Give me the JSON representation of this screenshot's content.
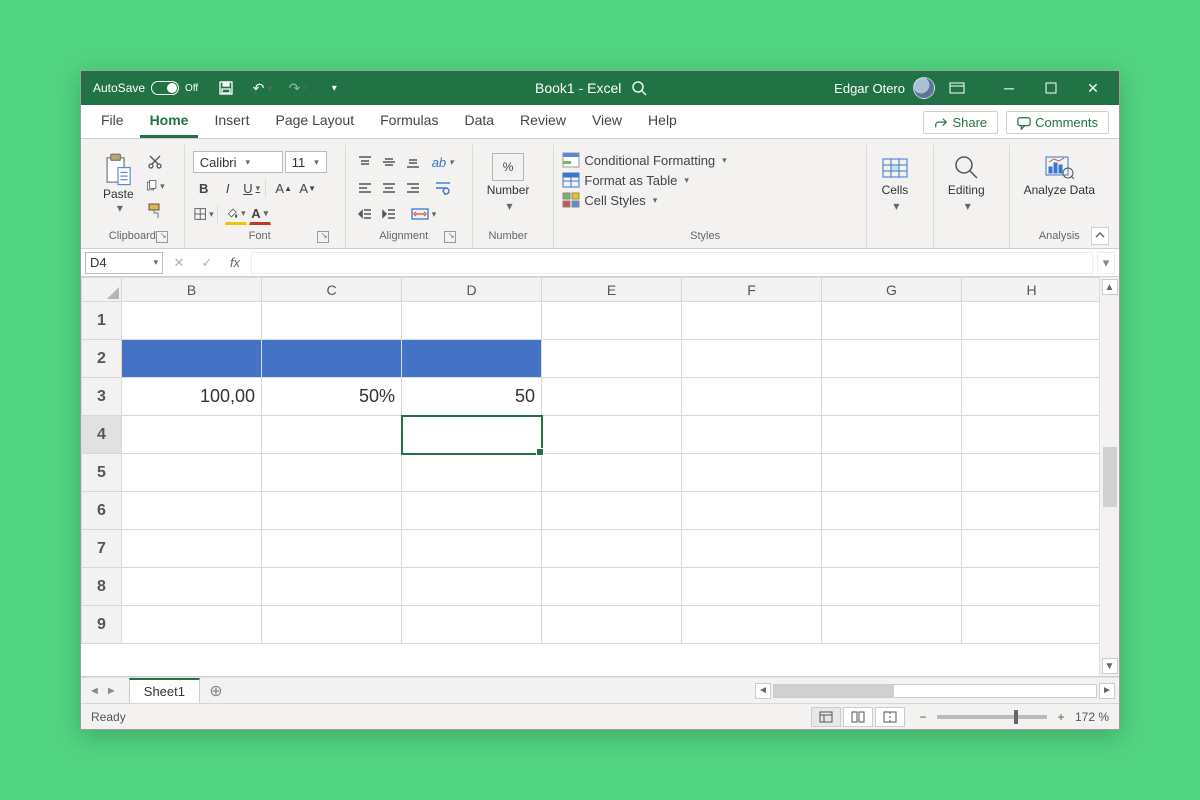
{
  "titlebar": {
    "autosave_label": "AutoSave",
    "autosave_state": "Off",
    "doc_title": "Book1 - Excel",
    "search_icon": "search-icon",
    "user_name": "Edgar Otero"
  },
  "tabs": {
    "items": [
      "File",
      "Home",
      "Insert",
      "Page Layout",
      "Formulas",
      "Data",
      "Review",
      "View",
      "Help"
    ],
    "active_index": 1,
    "share_label": "Share",
    "comments_label": "Comments"
  },
  "ribbon": {
    "clipboard": {
      "paste_label": "Paste",
      "group_label": "Clipboard"
    },
    "font": {
      "font_name": "Calibri",
      "font_size": "11",
      "group_label": "Font",
      "bold": "B",
      "italic": "I",
      "underline": "U"
    },
    "alignment": {
      "group_label": "Alignment"
    },
    "number": {
      "label": "Number",
      "group_label": "Number"
    },
    "styles": {
      "cond_format": "Conditional Formatting",
      "format_table": "Format as Table",
      "cell_styles": "Cell Styles",
      "group_label": "Styles"
    },
    "cells": {
      "label": "Cells"
    },
    "editing": {
      "label": "Editing"
    },
    "analysis": {
      "label": "Analyze Data",
      "group_label": "Analysis"
    }
  },
  "formula_bar": {
    "name_box": "D4",
    "fx_label": "fx",
    "formula": ""
  },
  "grid": {
    "columns": [
      "B",
      "C",
      "D",
      "E",
      "F",
      "G",
      "H"
    ],
    "rows": [
      "1",
      "2",
      "3",
      "4",
      "5",
      "6",
      "7",
      "8",
      "9"
    ],
    "active_col": "D",
    "active_row": "4",
    "cells": {
      "B3": "100,00",
      "C3": "50%",
      "D3": "50"
    },
    "highlight_row2": [
      "B",
      "C",
      "D"
    ]
  },
  "sheets": {
    "items": [
      "Sheet1"
    ],
    "active_index": 0
  },
  "statusbar": {
    "status": "Ready",
    "zoom": "172 %"
  }
}
